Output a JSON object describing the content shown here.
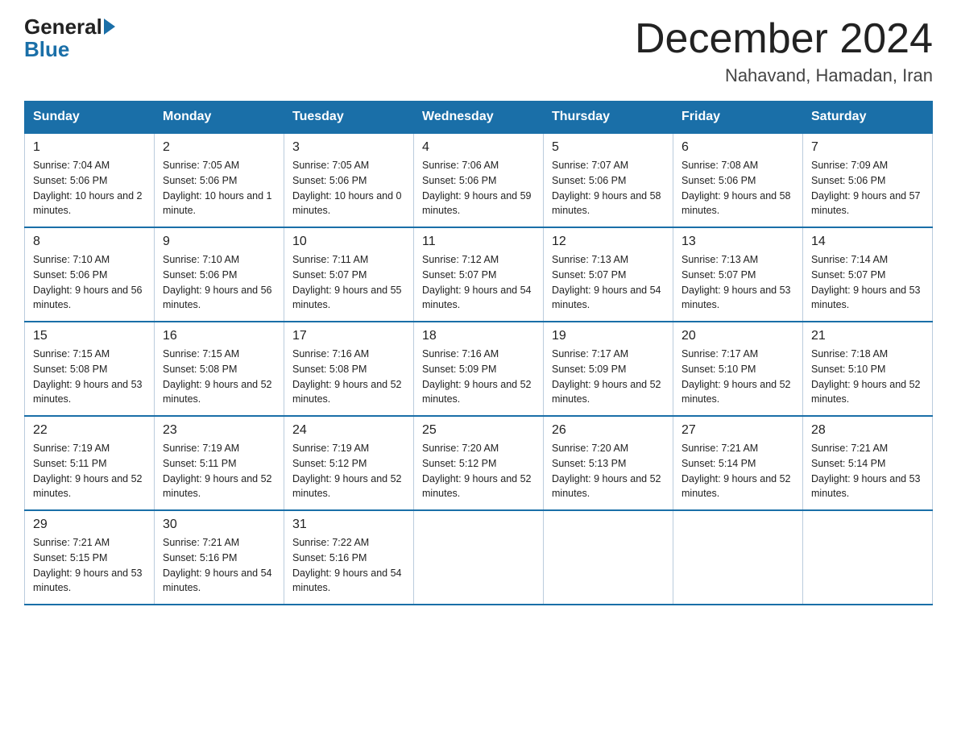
{
  "header": {
    "logo": {
      "general": "General",
      "blue": "Blue"
    },
    "title": "December 2024",
    "location": "Nahavand, Hamadan, Iran"
  },
  "weekdays": [
    "Sunday",
    "Monday",
    "Tuesday",
    "Wednesday",
    "Thursday",
    "Friday",
    "Saturday"
  ],
  "weeks": [
    [
      {
        "day": "1",
        "sunrise": "7:04 AM",
        "sunset": "5:06 PM",
        "daylight": "10 hours and 2 minutes."
      },
      {
        "day": "2",
        "sunrise": "7:05 AM",
        "sunset": "5:06 PM",
        "daylight": "10 hours and 1 minute."
      },
      {
        "day": "3",
        "sunrise": "7:05 AM",
        "sunset": "5:06 PM",
        "daylight": "10 hours and 0 minutes."
      },
      {
        "day": "4",
        "sunrise": "7:06 AM",
        "sunset": "5:06 PM",
        "daylight": "9 hours and 59 minutes."
      },
      {
        "day": "5",
        "sunrise": "7:07 AM",
        "sunset": "5:06 PM",
        "daylight": "9 hours and 58 minutes."
      },
      {
        "day": "6",
        "sunrise": "7:08 AM",
        "sunset": "5:06 PM",
        "daylight": "9 hours and 58 minutes."
      },
      {
        "day": "7",
        "sunrise": "7:09 AM",
        "sunset": "5:06 PM",
        "daylight": "9 hours and 57 minutes."
      }
    ],
    [
      {
        "day": "8",
        "sunrise": "7:10 AM",
        "sunset": "5:06 PM",
        "daylight": "9 hours and 56 minutes."
      },
      {
        "day": "9",
        "sunrise": "7:10 AM",
        "sunset": "5:06 PM",
        "daylight": "9 hours and 56 minutes."
      },
      {
        "day": "10",
        "sunrise": "7:11 AM",
        "sunset": "5:07 PM",
        "daylight": "9 hours and 55 minutes."
      },
      {
        "day": "11",
        "sunrise": "7:12 AM",
        "sunset": "5:07 PM",
        "daylight": "9 hours and 54 minutes."
      },
      {
        "day": "12",
        "sunrise": "7:13 AM",
        "sunset": "5:07 PM",
        "daylight": "9 hours and 54 minutes."
      },
      {
        "day": "13",
        "sunrise": "7:13 AM",
        "sunset": "5:07 PM",
        "daylight": "9 hours and 53 minutes."
      },
      {
        "day": "14",
        "sunrise": "7:14 AM",
        "sunset": "5:07 PM",
        "daylight": "9 hours and 53 minutes."
      }
    ],
    [
      {
        "day": "15",
        "sunrise": "7:15 AM",
        "sunset": "5:08 PM",
        "daylight": "9 hours and 53 minutes."
      },
      {
        "day": "16",
        "sunrise": "7:15 AM",
        "sunset": "5:08 PM",
        "daylight": "9 hours and 52 minutes."
      },
      {
        "day": "17",
        "sunrise": "7:16 AM",
        "sunset": "5:08 PM",
        "daylight": "9 hours and 52 minutes."
      },
      {
        "day": "18",
        "sunrise": "7:16 AM",
        "sunset": "5:09 PM",
        "daylight": "9 hours and 52 minutes."
      },
      {
        "day": "19",
        "sunrise": "7:17 AM",
        "sunset": "5:09 PM",
        "daylight": "9 hours and 52 minutes."
      },
      {
        "day": "20",
        "sunrise": "7:17 AM",
        "sunset": "5:10 PM",
        "daylight": "9 hours and 52 minutes."
      },
      {
        "day": "21",
        "sunrise": "7:18 AM",
        "sunset": "5:10 PM",
        "daylight": "9 hours and 52 minutes."
      }
    ],
    [
      {
        "day": "22",
        "sunrise": "7:19 AM",
        "sunset": "5:11 PM",
        "daylight": "9 hours and 52 minutes."
      },
      {
        "day": "23",
        "sunrise": "7:19 AM",
        "sunset": "5:11 PM",
        "daylight": "9 hours and 52 minutes."
      },
      {
        "day": "24",
        "sunrise": "7:19 AM",
        "sunset": "5:12 PM",
        "daylight": "9 hours and 52 minutes."
      },
      {
        "day": "25",
        "sunrise": "7:20 AM",
        "sunset": "5:12 PM",
        "daylight": "9 hours and 52 minutes."
      },
      {
        "day": "26",
        "sunrise": "7:20 AM",
        "sunset": "5:13 PM",
        "daylight": "9 hours and 52 minutes."
      },
      {
        "day": "27",
        "sunrise": "7:21 AM",
        "sunset": "5:14 PM",
        "daylight": "9 hours and 52 minutes."
      },
      {
        "day": "28",
        "sunrise": "7:21 AM",
        "sunset": "5:14 PM",
        "daylight": "9 hours and 53 minutes."
      }
    ],
    [
      {
        "day": "29",
        "sunrise": "7:21 AM",
        "sunset": "5:15 PM",
        "daylight": "9 hours and 53 minutes."
      },
      {
        "day": "30",
        "sunrise": "7:21 AM",
        "sunset": "5:16 PM",
        "daylight": "9 hours and 54 minutes."
      },
      {
        "day": "31",
        "sunrise": "7:22 AM",
        "sunset": "5:16 PM",
        "daylight": "9 hours and 54 minutes."
      },
      null,
      null,
      null,
      null
    ]
  ]
}
